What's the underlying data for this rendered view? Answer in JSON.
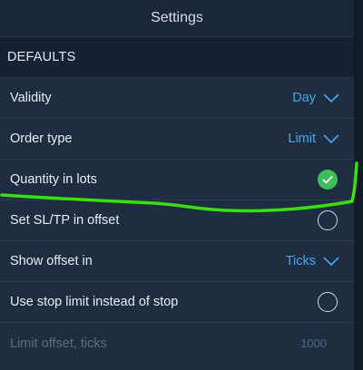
{
  "header": {
    "title": "Settings"
  },
  "section": {
    "title": "DEFAULTS"
  },
  "rows": [
    {
      "label": "Validity",
      "value": "Day"
    },
    {
      "label": "Order type",
      "value": "Limit"
    },
    {
      "label": "Quantity in lots",
      "checked": true
    },
    {
      "label": "Set SL/TP in offset",
      "checked": false
    },
    {
      "label": "Show offset in",
      "value": "Ticks"
    },
    {
      "label": "Use stop limit instead of stop",
      "checked": false
    },
    {
      "label": "Limit offset, ticks",
      "value": "1000",
      "enabled": false
    }
  ],
  "colors": {
    "accent": "#3fa9f5",
    "check_green": "#3cbf5a",
    "annotation_green": "#39e011",
    "panel_bg": "#1f2d40"
  },
  "icons": {
    "dropdown": "chevron-down-icon",
    "toggle_on": "checkmark-circle-icon",
    "toggle_off": "empty-circle-icon"
  }
}
